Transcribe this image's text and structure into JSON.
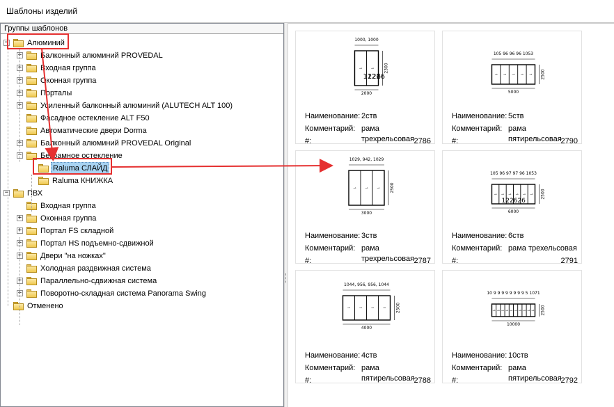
{
  "window": {
    "title": "Шаблоны изделий"
  },
  "left_panel": {
    "header": "Группы шаблонов",
    "tree": [
      {
        "label": "Алюминий",
        "expander": "−",
        "icon": "folder-icon"
      },
      {
        "label": "Балконный алюминий PROVEDAL",
        "expander": "+"
      },
      {
        "label": "Входная группа",
        "expander": "+"
      },
      {
        "label": "Оконная группа",
        "expander": "+"
      },
      {
        "label": "Порталы",
        "expander": "+"
      },
      {
        "label": "Усиленный балконный алюминий (ALUTECH ALT 100)",
        "expander": "+"
      },
      {
        "label": "Фасадное остекление ALT F50",
        "expander": ""
      },
      {
        "label": "Автоматические двери Dorma",
        "expander": ""
      },
      {
        "label": "Балконный алюминий PROVEDAL Original",
        "expander": "+"
      },
      {
        "label": "Безрамное остекление",
        "expander": "−"
      },
      {
        "label": "Raluma СЛАЙД",
        "expander": "",
        "selected": true
      },
      {
        "label": "Raluma КНИЖКА",
        "expander": ""
      },
      {
        "label": "ПВХ",
        "expander": "−"
      },
      {
        "label": "Входная группа",
        "expander": ""
      },
      {
        "label": "Оконная группа",
        "expander": "+"
      },
      {
        "label": "Портал FS складной",
        "expander": "+"
      },
      {
        "label": "Портал HS подъемно-сдвижной",
        "expander": "+"
      },
      {
        "label": "Двери \"на ножках\"",
        "expander": "+"
      },
      {
        "label": "Холодная раздвижная система",
        "expander": ""
      },
      {
        "label": "Параллельно-сдвижная система",
        "expander": "+"
      },
      {
        "label": "Поворотно-складная система Panorama Swing",
        "expander": "+"
      },
      {
        "label": "Отменено",
        "expander": ""
      }
    ]
  },
  "labels": {
    "name": "Наименование:",
    "comment": "Комментарий:",
    "id": "#:"
  },
  "cards": [
    {
      "name": "2ств",
      "comment": "рама трехрельсовая",
      "id": "2786",
      "dims": [
        "1000, 1000",
        "2300",
        "2000",
        "1226",
        "1226"
      ]
    },
    {
      "name": "5ств",
      "comment": "рама пятирельсовая",
      "id": "2790",
      "dims": [
        "105 96 96 96 1053",
        "2500",
        "5000"
      ]
    },
    {
      "name": "3ств",
      "comment": "рама трехрельсовая",
      "id": "2787",
      "dims": [
        "1029, 942, 1029",
        "2500",
        "3000"
      ]
    },
    {
      "name": "6ств",
      "comment": "рама трехельсовая",
      "id": "2791",
      "dims": [
        "105 96 97 97 96 1053",
        "2500",
        "1226",
        "1226",
        "6000"
      ]
    },
    {
      "name": "4ств",
      "comment": "рама пятирельсовая",
      "id": "2788",
      "dims": [
        "1044, 956, 956, 1044",
        "2500",
        "4000"
      ]
    },
    {
      "name": "10ств",
      "comment": "рама пятирельсовая",
      "id": "2792",
      "dims": [
        "10 9 9 9 9 9 9 9 9 5 1071",
        "2500",
        "10000"
      ]
    }
  ],
  "colors": {
    "annotation_red": "#e53030",
    "selection": "#a8d3f2",
    "folder": "#f0c94f"
  }
}
